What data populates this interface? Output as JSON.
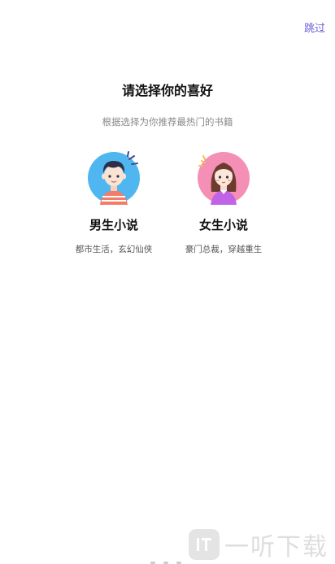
{
  "header": {
    "skip_label": "跳过"
  },
  "main": {
    "title": "请选择你的喜好",
    "subtitle": "根据选择为你推荐最热门的书籍"
  },
  "options": [
    {
      "title": "男生小说",
      "desc": "都市生活，玄幻仙侠",
      "icon": "male-avatar-icon",
      "circle_color": "#4fb6f0"
    },
    {
      "title": "女生小说",
      "desc": "豪门总裁，穿越重生",
      "icon": "female-avatar-icon",
      "circle_color": "#f48fb5"
    }
  ],
  "colors": {
    "accent": "#6b5fd6",
    "text_primary": "#111111",
    "text_secondary": "#8a8a8a"
  },
  "watermark": {
    "text": "一听下载"
  }
}
